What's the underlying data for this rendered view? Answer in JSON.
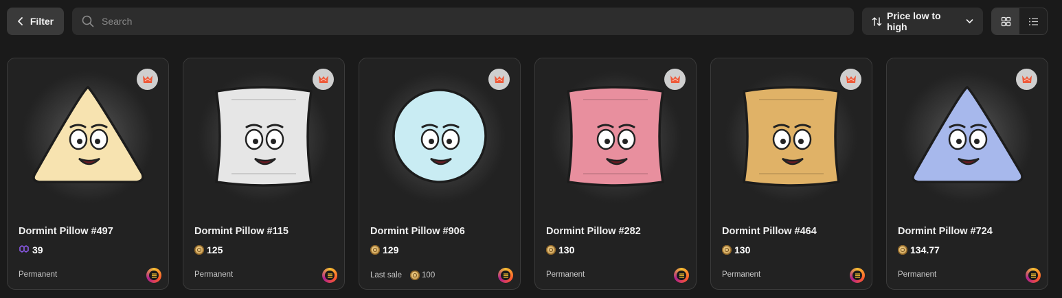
{
  "toolbar": {
    "filter_label": "Filter",
    "search_placeholder": "Search",
    "sort_label": "Price low to high",
    "view_modes": [
      "grid",
      "list"
    ],
    "active_view": "grid"
  },
  "items": [
    {
      "name": "Dormint Pillow #497",
      "price": "39",
      "currency_icon": "polygon-icon",
      "footer": "Permanent",
      "footer_value": "",
      "shape": "triangle",
      "color": "#f7e3b0"
    },
    {
      "name": "Dormint Pillow #115",
      "price": "125",
      "currency_icon": "coin-icon",
      "footer": "Permanent",
      "footer_value": "",
      "shape": "square",
      "color": "#e6e6e6"
    },
    {
      "name": "Dormint Pillow #906",
      "price": "129",
      "currency_icon": "coin-icon",
      "footer": "Last sale",
      "footer_value": "100",
      "shape": "circle",
      "color": "#c9ecf3"
    },
    {
      "name": "Dormint Pillow #282",
      "price": "130",
      "currency_icon": "coin-icon",
      "footer": "Permanent",
      "footer_value": "",
      "shape": "square",
      "color": "#e88f9e"
    },
    {
      "name": "Dormint Pillow #464",
      "price": "130",
      "currency_icon": "coin-icon",
      "footer": "Permanent",
      "footer_value": "",
      "shape": "square",
      "color": "#e0b267"
    },
    {
      "name": "Dormint Pillow #724",
      "price": "134.77",
      "currency_icon": "coin-icon",
      "footer": "Permanent",
      "footer_value": "",
      "shape": "triangle",
      "color": "#a7b8ec"
    }
  ]
}
